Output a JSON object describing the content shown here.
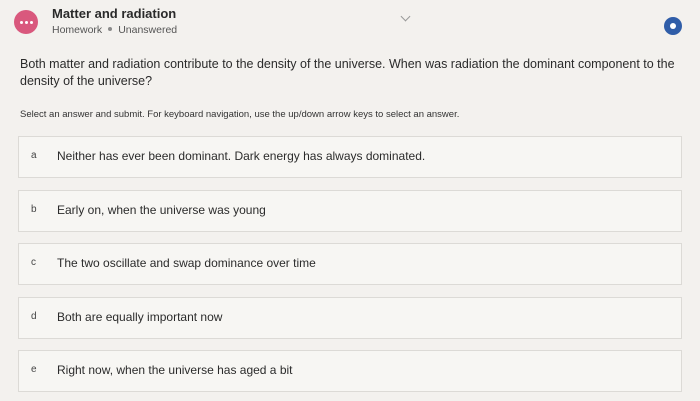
{
  "header": {
    "title": "Matter and radiation",
    "assignment_type": "Homework",
    "status": "Unanswered"
  },
  "question": {
    "text": "Both matter and radiation contribute to the density of the universe. When was radiation the dominant component to the density of the universe?",
    "instructions": "Select an answer and submit. For keyboard navigation, use the up/down arrow keys to select an answer."
  },
  "options": [
    {
      "letter": "a",
      "text": "Neither has ever been dominant. Dark energy has always dominated."
    },
    {
      "letter": "b",
      "text": "Early on, when the universe was young"
    },
    {
      "letter": "c",
      "text": "The two oscillate and swap dominance over time"
    },
    {
      "letter": "d",
      "text": "Both are equally important now"
    },
    {
      "letter": "e",
      "text": "Right now, when the universe has aged a bit"
    }
  ],
  "icons": {
    "menu": "more-options-icon",
    "dropdown": "chevron-down-icon",
    "settings": "settings-icon"
  },
  "colors": {
    "menu_accent": "#d9587d",
    "settings_accent": "#2f5da8",
    "background": "#f3f1ee"
  }
}
